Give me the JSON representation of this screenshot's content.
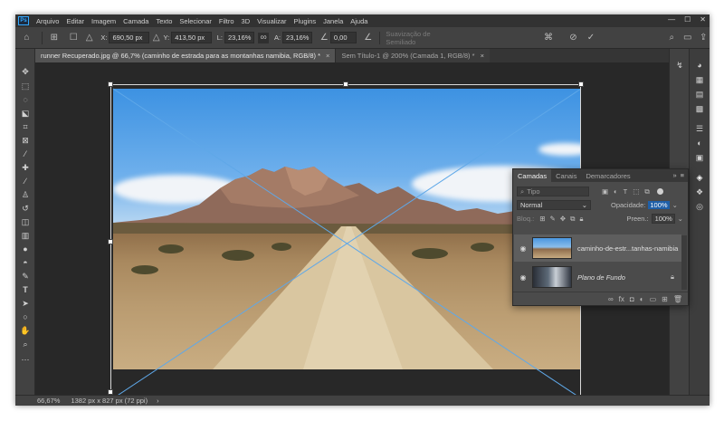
{
  "menu": {
    "logo": "Ps",
    "items": [
      "Arquivo",
      "Editar",
      "Imagem",
      "Camada",
      "Texto",
      "Selecionar",
      "Filtro",
      "3D",
      "Visualizar",
      "Plugins",
      "Janela",
      "Ajuda"
    ]
  },
  "options": {
    "x_label": "X:",
    "x_value": "690,50 px",
    "y_label": "Y:",
    "y_value": "413,50 px",
    "w_label": "L:",
    "w_value": "23,16%",
    "h_label": "A:",
    "h_value": "23,16%",
    "angle_value": "0,00",
    "interpolation": "Suavização de Semiliado"
  },
  "tabs": [
    {
      "label": "runner Recuperado.jpg @ 66,7% (caminho de estrada para as montanhas namibia, RGB/8) *",
      "close": "×"
    },
    {
      "label": "Sem Título-1 @ 200% (Camada 1, RGB/8) *",
      "close": "×"
    }
  ],
  "status": {
    "zoom": "66,67%",
    "doc_size": "1382 px x 827 px (72 ppi)",
    "arrow": "›"
  },
  "layers_panel": {
    "tabs": [
      "Camadas",
      "Canais",
      "Demarcadores"
    ],
    "search_placeholder": "Tipo",
    "blend_mode": "Normal",
    "opacity_label": "Opacidade:",
    "opacity_value": "100%",
    "lock_label": "Bloq.:",
    "fill_label": "Preen.:",
    "fill_value": "100%",
    "layers": [
      {
        "name": "caminho-de-estr...tanhas-namibia",
        "selected": true
      },
      {
        "name": "Plano de Fundo",
        "selected": false
      }
    ]
  },
  "colors": {
    "foreground": "#000000",
    "background": "#ffffff",
    "accent": "#31a8ff"
  }
}
